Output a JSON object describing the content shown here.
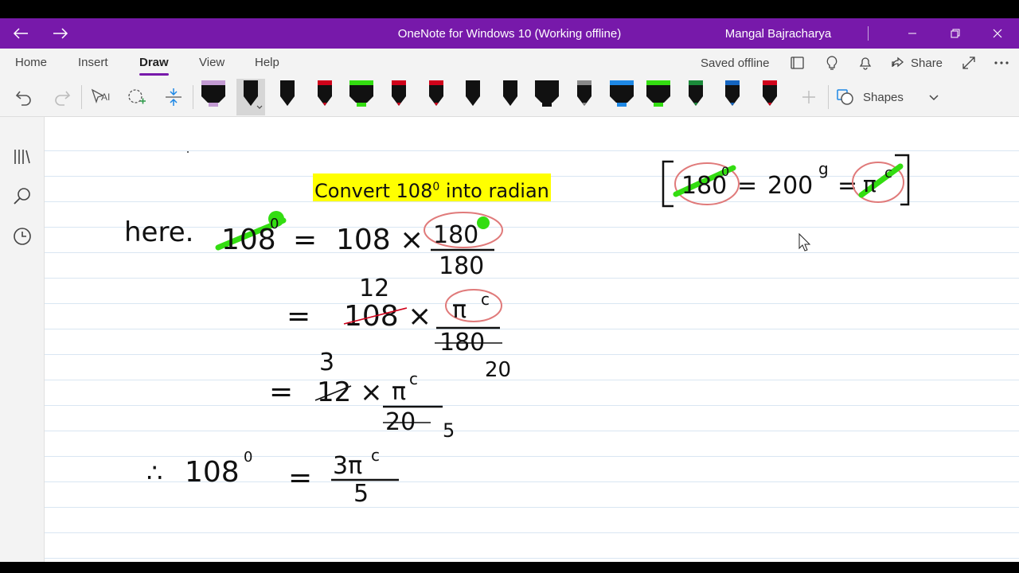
{
  "window": {
    "title": "OneNote for Windows 10 (Working offline)",
    "user": "Mangal Bajracharya",
    "back_icon": "arrow-left-icon",
    "forward_icon": "arrow-right-icon"
  },
  "ribbon": {
    "tabs": [
      {
        "label": "Home"
      },
      {
        "label": "Insert"
      },
      {
        "label": "Draw",
        "active": true
      },
      {
        "label": "View"
      },
      {
        "label": "Help"
      }
    ],
    "status": "Saved offline",
    "share_label": "Share",
    "accent_color": "#7719aa"
  },
  "toolbar": {
    "shapes_label": "Shapes",
    "pens": [
      {
        "name": "highlighter-purple",
        "color": "#c39bd3"
      },
      {
        "name": "pen-black-selected",
        "color": "#111111"
      },
      {
        "name": "pen-black",
        "color": "#111111"
      },
      {
        "name": "pen-red",
        "color": "#d0021b"
      },
      {
        "name": "highlighter-green",
        "color": "#33dd11"
      },
      {
        "name": "pen-red-pattern",
        "color": "#d0021b"
      },
      {
        "name": "pen-red-2",
        "color": "#d0021b"
      },
      {
        "name": "pen-black-2",
        "color": "#111111"
      },
      {
        "name": "pen-black-3",
        "color": "#111111"
      },
      {
        "name": "highlighter-black",
        "color": "#111111"
      },
      {
        "name": "pen-gray",
        "color": "#888888"
      },
      {
        "name": "highlighter-blue",
        "color": "#1e88e5"
      },
      {
        "name": "highlighter-green-2",
        "color": "#33dd11"
      },
      {
        "name": "pen-green",
        "color": "#1b8a3a"
      },
      {
        "name": "pen-blue",
        "color": "#1565c0"
      },
      {
        "name": "pen-red-3",
        "color": "#d0021b"
      }
    ]
  },
  "note": {
    "heading_text": "Convert 108",
    "heading_sup": "0",
    "heading_rest": " into radian",
    "highlight_color": "#ffff00",
    "ink": {
      "here": "here.",
      "line1_lhs": "108",
      "deg": "0",
      "eq": "=",
      "line1_rhs": "108 ×",
      "frac1_num": "180",
      "frac1_den": "180",
      "twelve": "12",
      "line2_rhs": "108 ×",
      "pi_c": "π",
      "c": "c",
      "frac2_den": "180",
      "twenty": "20",
      "three": "3",
      "line3_rhs": "12 ×",
      "frac3_den": "20",
      "five": "5",
      "therefore": "∴",
      "final_lhs": "108",
      "final_num": "3π",
      "final_den": "5",
      "box_a": "180",
      "box_b": "200",
      "box_g": "g"
    }
  }
}
